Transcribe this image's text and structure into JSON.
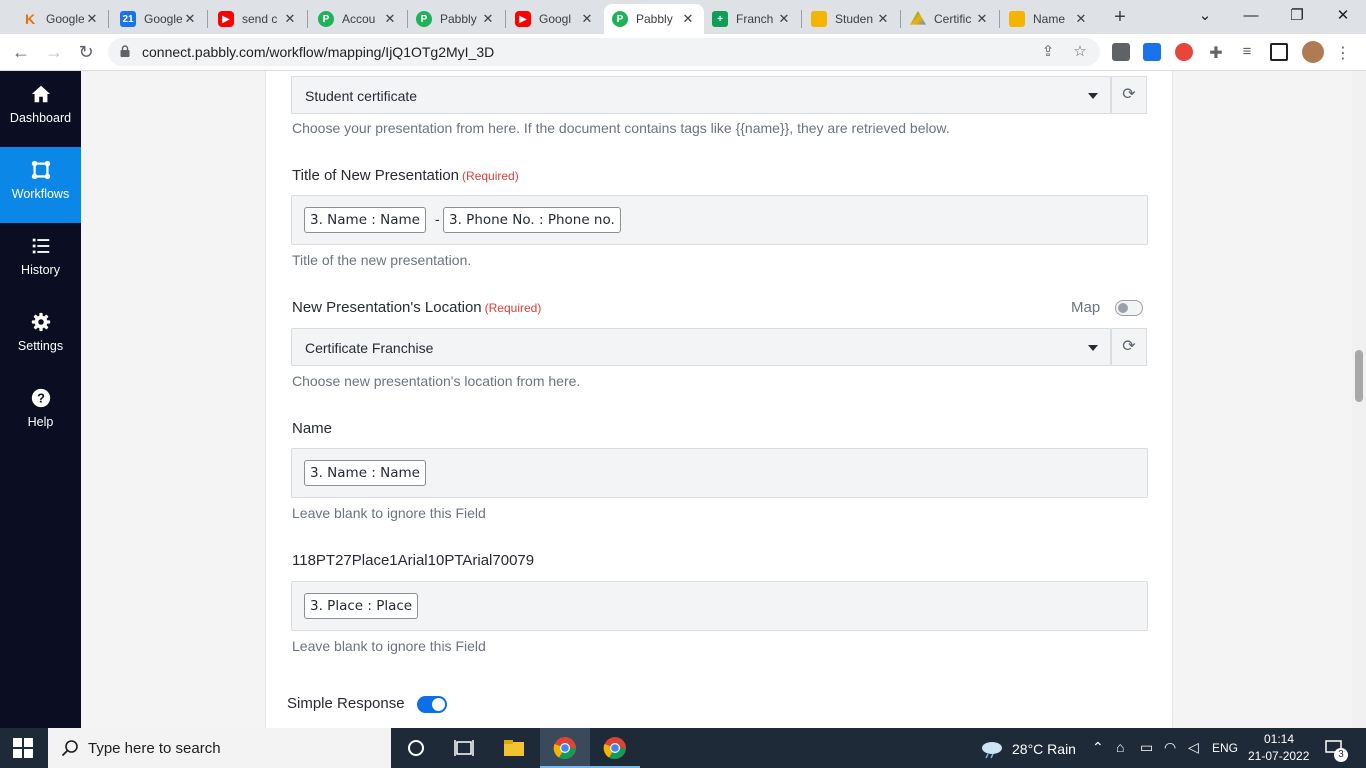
{
  "browser": {
    "tabs": [
      {
        "title": "Google",
        "favicon": "k-icon",
        "color": "#e8710a",
        "active": false
      },
      {
        "title": "Google",
        "favicon": "calendar-icon",
        "color": "#1a73e8",
        "active": false
      },
      {
        "title": "send c",
        "favicon": "youtube-icon",
        "color": "#ff0000",
        "active": false
      },
      {
        "title": "Accou",
        "favicon": "pabbly-icon",
        "color": "#20b15a",
        "active": false
      },
      {
        "title": "Pabbly",
        "favicon": "pabbly-icon",
        "color": "#20b15a",
        "active": false
      },
      {
        "title": "Googl",
        "favicon": "youtube-icon",
        "color": "#ff0000",
        "active": false
      },
      {
        "title": "Pabbly",
        "favicon": "pabbly-icon",
        "color": "#20b15a",
        "active": true
      },
      {
        "title": "Franch",
        "favicon": "sheets-icon",
        "color": "#0f9d58",
        "active": false
      },
      {
        "title": "Studen",
        "favicon": "slides-icon",
        "color": "#f4b400",
        "active": false
      },
      {
        "title": "Certific",
        "favicon": "drive-icon",
        "color": "#4285f4",
        "active": false
      },
      {
        "title": "Name",
        "favicon": "slides-icon",
        "color": "#f4b400",
        "active": false
      }
    ],
    "url": "connect.pabbly.com/workflow/mapping/IjQ1OTg2MyI_3D"
  },
  "sidebar": {
    "items": [
      {
        "label": "Dashboard",
        "icon": "home-icon",
        "active": false
      },
      {
        "label": "Workflows",
        "icon": "workflow-icon",
        "active": true
      },
      {
        "label": "History",
        "icon": "list-icon",
        "active": false
      },
      {
        "label": "Settings",
        "icon": "gear-icon",
        "active": false
      },
      {
        "label": "Help",
        "icon": "question-icon",
        "active": false
      }
    ]
  },
  "form": {
    "presentation": {
      "value": "Student certificate",
      "help": "Choose your presentation from here. If the document contains tags like {{name}}, they are retrieved below."
    },
    "title_field": {
      "label": "Title of New Presentation",
      "required": "(Required)",
      "chips": [
        "3. Name : Name",
        "3. Phone No. : Phone no."
      ],
      "separator": "-",
      "help": "Title of the new presentation."
    },
    "location": {
      "label": "New Presentation's Location",
      "required": "(Required)",
      "map_label": "Map",
      "value": "Certificate Franchise",
      "help": "Choose new presentation's location from here."
    },
    "name_field": {
      "label": "Name",
      "chip": "3. Name : Name",
      "help": "Leave blank to ignore this Field"
    },
    "place_field": {
      "label": "118PT27Place1Arial10PTArial70079",
      "chip": "3. Place : Place",
      "help": "Leave blank to ignore this Field"
    },
    "simple_response": {
      "label": "Simple Response",
      "enabled": true
    }
  },
  "taskbar": {
    "search_placeholder": "Type here to search",
    "weather": "28°C  Rain",
    "lang": "ENG",
    "time": "01:14",
    "date": "21-07-2022",
    "notifications": "3"
  },
  "colors": {
    "sidebar_bg": "#0b0e22",
    "sidebar_active": "#0b87e8",
    "required": "#e03c3c",
    "toggle_on": "#0b6fe8"
  }
}
